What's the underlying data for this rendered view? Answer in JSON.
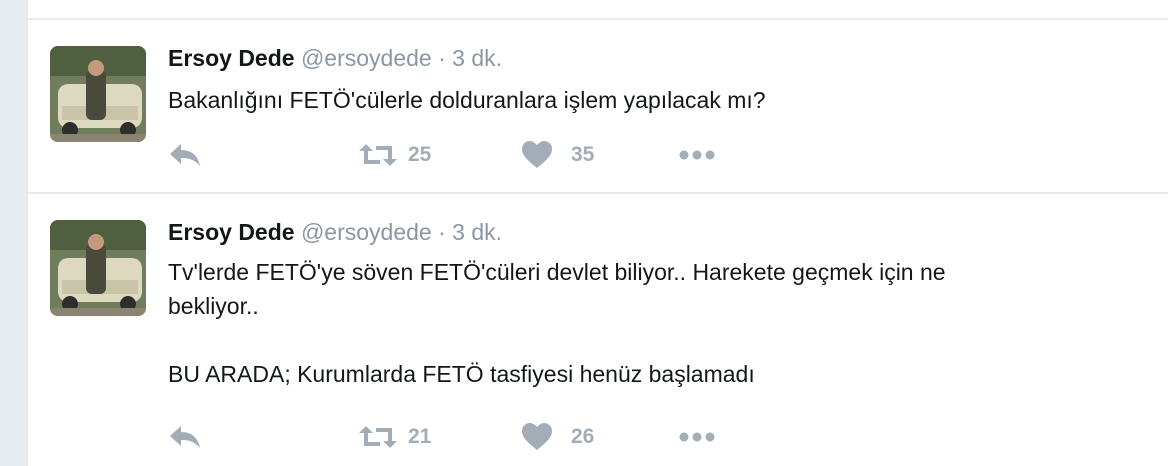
{
  "tweets": [
    {
      "fullname": "Ersoy Dede",
      "handle": "@ersoydede",
      "separator": "·",
      "time": "3 dk.",
      "text": "Bakanlığını FETÖ'cülerle dolduranlara işlem yapılacak mı?",
      "retweets": "25",
      "likes": "35"
    },
    {
      "fullname": "Ersoy Dede",
      "handle": "@ersoydede",
      "separator": "·",
      "time": "3 dk.",
      "text": "Tv'lerde FETÖ'ye söven FETÖ'cüleri devlet biliyor.. Harekete geçmek için ne\nbekliyor..\n\nBU ARADA; Kurumlarda FETÖ tasfiyesi henüz başlamadı",
      "retweets": "21",
      "likes": "26"
    }
  ],
  "icons": {
    "reply": "reply-icon",
    "retweet": "retweet-icon",
    "like": "heart-icon",
    "more": "more-icon"
  },
  "colors": {
    "name": "#14171a",
    "meta": "#8a97a3",
    "action": "#a2adb8",
    "background": "#e6ecf0"
  }
}
